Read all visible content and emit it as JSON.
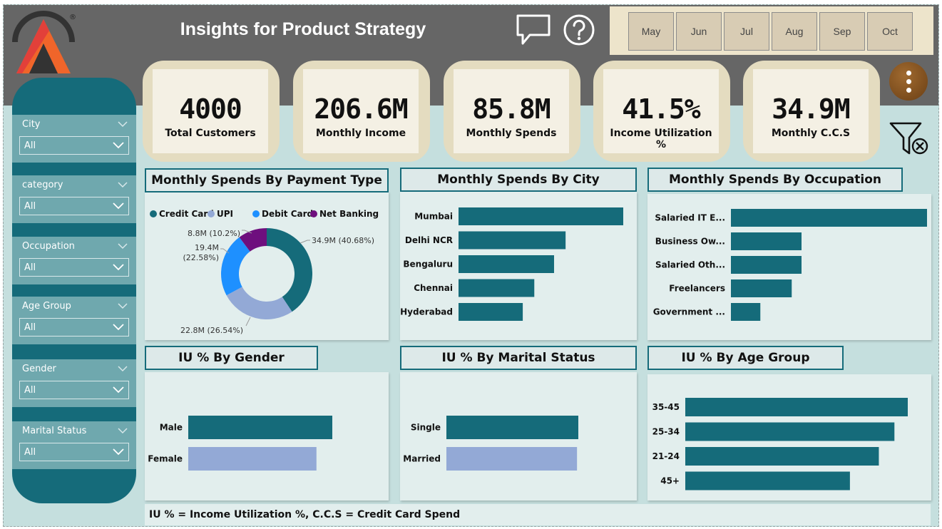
{
  "header": {
    "title": "Insights for Product Strategy",
    "icons": [
      "chat-bubble-icon",
      "help-icon"
    ],
    "months": [
      "May",
      "Jun",
      "Jul",
      "Aug",
      "Sep",
      "Oct"
    ]
  },
  "kpis": [
    {
      "value": "4000",
      "label": "Total Customers"
    },
    {
      "value": "206.6M",
      "label": "Monthly Income"
    },
    {
      "value": "85.8M",
      "label": "Monthly Spends"
    },
    {
      "value": "41.5%",
      "label": "Income Utilization %"
    },
    {
      "value": "34.9M",
      "label": "Monthly C.C.S"
    }
  ],
  "slicers": [
    {
      "title": "City",
      "value": "All"
    },
    {
      "title": "category",
      "value": "All"
    },
    {
      "title": "Occupation",
      "value": "All"
    },
    {
      "title": "Age Group",
      "value": "All"
    },
    {
      "title": "Gender",
      "value": "All"
    },
    {
      "title": "Marital Status",
      "value": "All"
    }
  ],
  "panels": {
    "payment": {
      "title": "Monthly Spends By Payment Type"
    },
    "city": {
      "title": "Monthly Spends By City"
    },
    "occupation": {
      "title": "Monthly Spends By Occupation"
    },
    "gender": {
      "title": "IU % By Gender"
    },
    "marital": {
      "title": "IU % By Marital Status"
    },
    "age": {
      "title": "IU % By Age Group"
    }
  },
  "footer_note": "IU % = Income Utilization %, C.C.S = Credit Card Spend",
  "colors": {
    "teal": "#156b7a",
    "lavender": "#93a9d6",
    "blue": "#1e90ff",
    "purple": "#6e0f7e",
    "header": "#666666",
    "cream": "#e4dcc0"
  },
  "chart_data": [
    {
      "type": "pie",
      "title": "Monthly Spends By Payment Type",
      "legend": "top",
      "categories": [
        "Credit Card",
        "UPI",
        "Debit Card",
        "Net Banking"
      ],
      "values": [
        34.9,
        22.8,
        19.4,
        8.8
      ],
      "labels": [
        "34.9M (40.68%)",
        "22.8M (26.54%)",
        "19.4M (22.58%)",
        "8.8M (10.2%)"
      ],
      "colors": [
        "#156b7a",
        "#93a9d6",
        "#1e90ff",
        "#6e0f7e"
      ]
    },
    {
      "type": "bar",
      "orientation": "horizontal",
      "title": "Monthly Spends By City",
      "categories": [
        "Mumbai",
        "Delhi NCR",
        "Bengaluru",
        "Chennai",
        "Hyderabad"
      ],
      "values": [
        100,
        65,
        58,
        46,
        39
      ],
      "xlim": [
        0,
        100
      ]
    },
    {
      "type": "bar",
      "orientation": "horizontal",
      "title": "Monthly Spends By Occupation",
      "categories": [
        "Salaried IT E...",
        "Business Ow...",
        "Salaried Oth...",
        "Freelancers",
        "Government ..."
      ],
      "values": [
        100,
        36,
        36,
        31,
        15
      ],
      "xlim": [
        0,
        100
      ]
    },
    {
      "type": "bar",
      "orientation": "horizontal",
      "title": "IU % By Gender",
      "categories": [
        "Male",
        "Female"
      ],
      "values": [
        100,
        89
      ],
      "colors": [
        "#156b7a",
        "#93a9d6"
      ],
      "xlim": [
        0,
        100
      ]
    },
    {
      "type": "bar",
      "orientation": "horizontal",
      "title": "IU % By Marital Status",
      "categories": [
        "Single",
        "Married"
      ],
      "values": [
        100,
        99
      ],
      "colors": [
        "#156b7a",
        "#93a9d6"
      ],
      "xlim": [
        0,
        100
      ]
    },
    {
      "type": "bar",
      "orientation": "horizontal",
      "title": "IU % By Age Group",
      "categories": [
        "35-45",
        "25-34",
        "21-24",
        "45+"
      ],
      "values": [
        100,
        94,
        87,
        74
      ],
      "xlim": [
        0,
        100
      ]
    }
  ]
}
